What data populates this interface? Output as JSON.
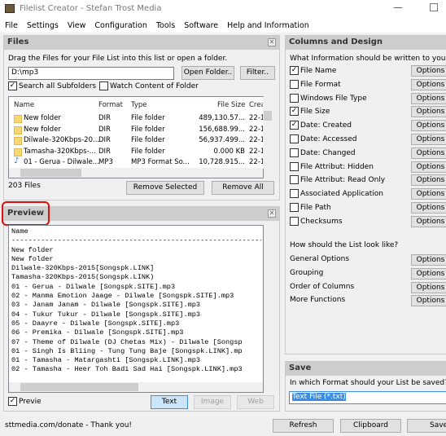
{
  "window": {
    "title": "Filelist Creator - Stefan Trost Media",
    "minimize": "—"
  },
  "menu": [
    "File",
    "Settings",
    "View",
    "Configuration",
    "Tools",
    "Software",
    "Help and Information"
  ],
  "files": {
    "title": "Files",
    "instruction": "Drag the Files for your File List into this list or open a folder.",
    "path": "D:\\mp3",
    "open_folder": "Open Folder..",
    "filter": "Filter..",
    "search_subfolders": {
      "label": "Search all Subfolders",
      "checked": true
    },
    "watch_folder": {
      "label": "Watch Content of Folder",
      "checked": false
    },
    "columns": [
      "Name",
      "Format",
      "Type",
      "File Size",
      "Crea"
    ],
    "rows": [
      {
        "icon": "folder",
        "name": "New folder",
        "format": "DIR",
        "type": "File folder",
        "size": "489,130.57...",
        "created": "22-1"
      },
      {
        "icon": "folder",
        "name": "New folder",
        "format": "DIR",
        "type": "File folder",
        "size": "156,688.99...",
        "created": "22-1"
      },
      {
        "icon": "folder",
        "name": "Dilwale-320Kbps-20...",
        "format": "DIR",
        "type": "File folder",
        "size": "56,937.499...",
        "created": "22-1"
      },
      {
        "icon": "folder",
        "name": "Tamasha-320Kbps-...",
        "format": "DIR",
        "type": "File folder",
        "size": "0.000 KB",
        "created": "22-1"
      },
      {
        "icon": "music",
        "name": "01 - Gerua - Dilwale...",
        "format": "MP3",
        "type": "MP3 Format So...",
        "size": "10,728.915...",
        "created": "22-1"
      }
    ],
    "count": "203 Files",
    "remove_selected": "Remove Selected",
    "remove_all": "Remove All"
  },
  "preview": {
    "title": "Preview",
    "lines": [
      "Name",
      "------------------------------------------------------------",
      "New folder",
      "New folder",
      "Dilwale-320Kbps-2015[Songspk.LINK]",
      "Tamasha-320Kbps-2015(Songspk.LINK)",
      "01 - Gerua - Dilwale [Songspk.SITE].mp3",
      "02 - Manma Emotion Jaage - Dilwale [Songspk.SITE].mp3",
      "03 - Janam Janam - Dilwale [Songspk.SITE].mp3",
      "04 - Tukur Tukur - Dilwale [Songspk.SITE].mp3",
      "05 - Daayre - Dilwale [Songspk.SITE].mp3",
      "06 - Premika - Dilwale [Songspk.SITE].mp3",
      "07 - Theme of Dilwale (DJ Chetas Mix) - Dilwale [Songsp",
      "01 - Singh Is Bliing - Tung Tung Baje [Songspk.LINK].mp",
      "01 - Tamasha - Matargashti [Songspk.LINK].mp3",
      "02 - Tamasha - Heer Toh Badi Sad Hai [Songspk.LINK].mp3"
    ],
    "preview_checkbox": {
      "label": "Previe",
      "checked": true
    },
    "text": "Text",
    "image": "Image",
    "web": "Web"
  },
  "columns_design": {
    "title": "Columns and Design",
    "question": "What Information should be written to your List?",
    "options_label": "Options",
    "items": [
      {
        "label": "File Name",
        "checked": true
      },
      {
        "label": "File Format",
        "checked": false
      },
      {
        "label": "Windows File Type",
        "checked": false
      },
      {
        "label": "File Size",
        "checked": true
      },
      {
        "label": "Date: Created",
        "checked": true
      },
      {
        "label": "Date: Accessed",
        "checked": false
      },
      {
        "label": "Date: Changed",
        "checked": false
      },
      {
        "label": "File Attribut: Hidden",
        "checked": false
      },
      {
        "label": "File Attribut: Read Only",
        "checked": false
      },
      {
        "label": "Associated Application",
        "checked": false
      },
      {
        "label": "File Path",
        "checked": false
      },
      {
        "label": "Checksums",
        "checked": false
      }
    ],
    "look_question": "How should the List look like?",
    "look_items": [
      "General Options",
      "Grouping",
      "Order of Columns",
      "More Functions"
    ]
  },
  "save": {
    "title": "Save",
    "question": "In which Format should your List be saved?",
    "format": "Text File (*.txt)"
  },
  "footer": {
    "donate": "sttmedia.com/donate - Thank you!",
    "refresh": "Refresh",
    "clipboard": "Clipboard",
    "save": "Save"
  }
}
